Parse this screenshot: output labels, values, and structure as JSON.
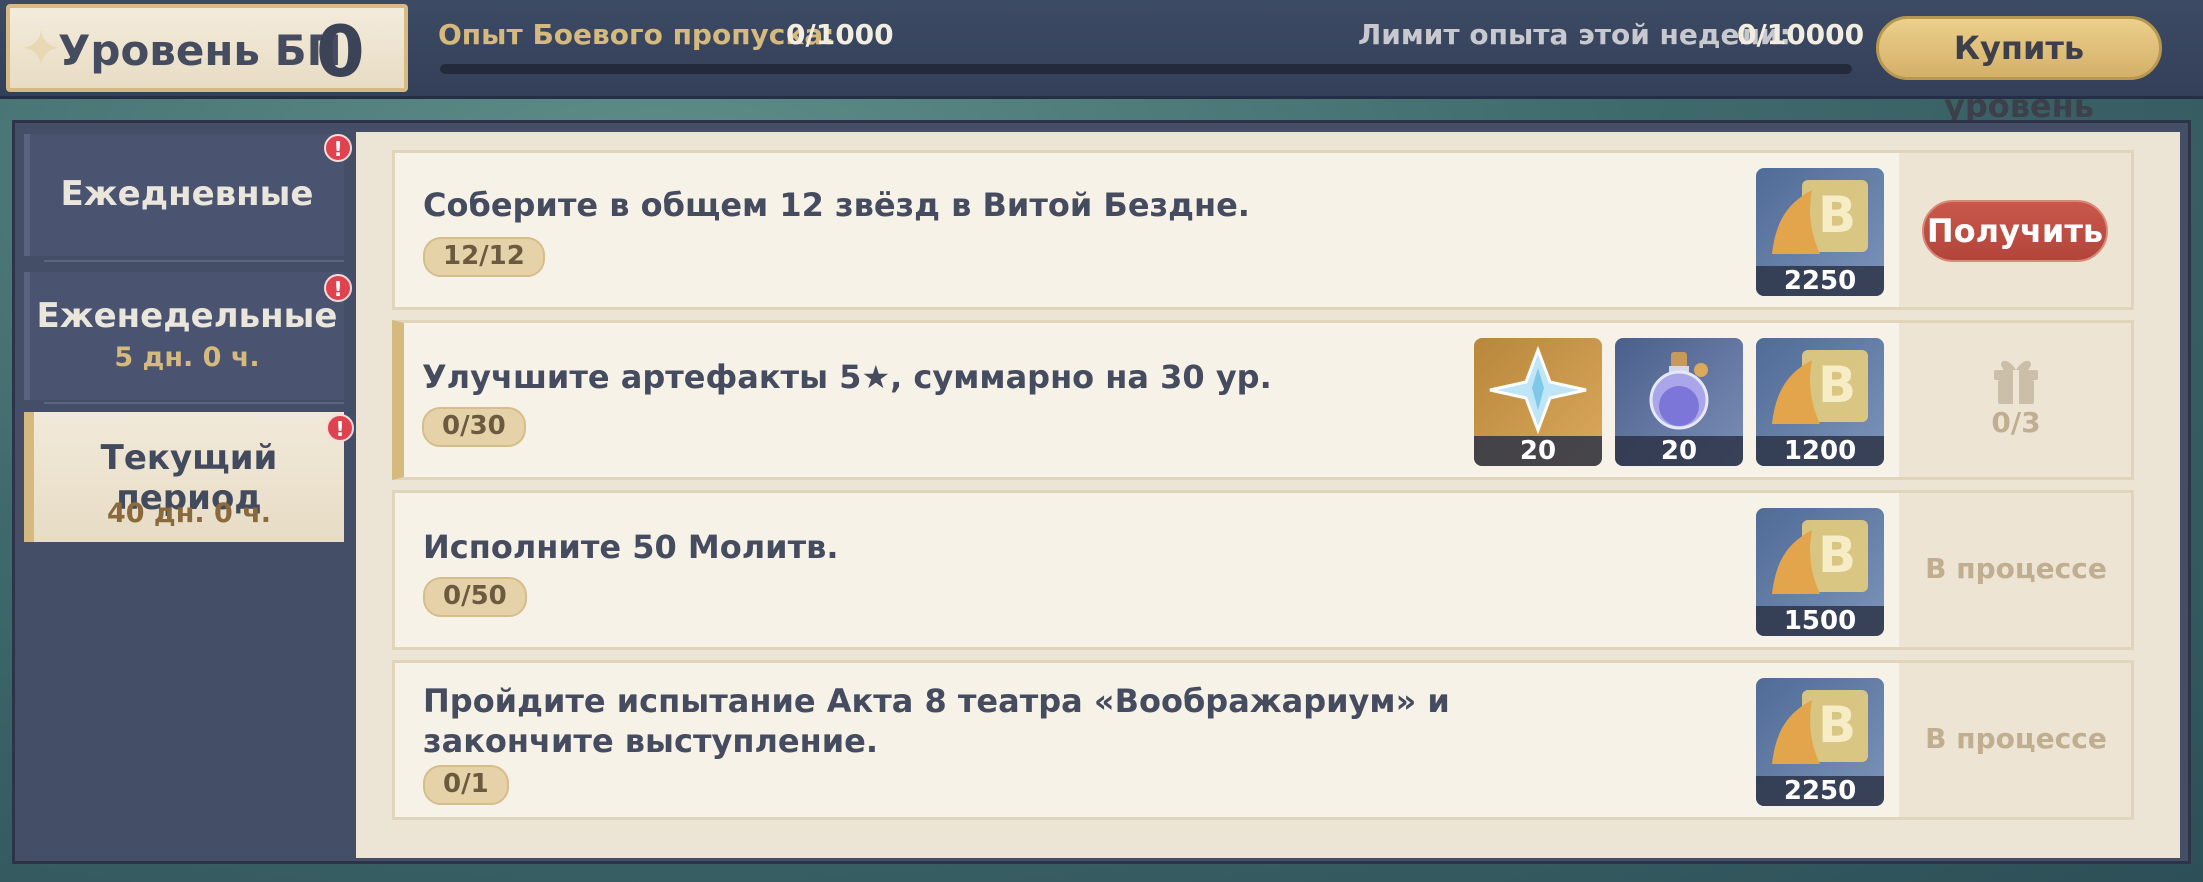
{
  "header": {
    "level_label": "Уровень БП",
    "level_value": "0",
    "exp_label": "Опыт Боевого пропуска:",
    "exp_value": "0/1000",
    "week_label": "Лимит опыта этой недели:",
    "week_value": "0/10000",
    "exp_progress_fraction": 0,
    "buy_button_label": "Купить уровень"
  },
  "tabs": [
    {
      "title": "Ежедневные",
      "subtitle": "",
      "alert": "!"
    },
    {
      "title": "Еженедельные",
      "subtitle": "5 дн. 0 ч.",
      "alert": "!"
    },
    {
      "title": "Текущий период",
      "subtitle": "40 дн. 0 ч.",
      "alert": "!"
    }
  ],
  "quests": [
    {
      "text": "Соберите в общем 12 звёзд в Витой Бездне.",
      "progress": "12/12",
      "rewards": [
        {
          "icon": "bp-exp-icon",
          "count": "2250"
        }
      ],
      "action": "Получить"
    },
    {
      "text": "Улучшите артефакты 5★, суммарно на 30 ур.",
      "progress": "0/30",
      "rewards": [
        {
          "icon": "primogem-icon",
          "count": "20"
        },
        {
          "icon": "fragile-resin-icon",
          "count": "20"
        },
        {
          "icon": "bp-exp-icon",
          "count": "1200"
        }
      ],
      "action": "0/3"
    },
    {
      "text": "Исполните 50 Молитв.",
      "progress": "0/50",
      "rewards": [
        {
          "icon": "bp-exp-icon",
          "count": "1500"
        }
      ],
      "action": "В процессе"
    },
    {
      "text": "Пройдите испытание Акта 8 театра «Воображариум» и закончите выступление.",
      "progress": "0/1",
      "rewards": [
        {
          "icon": "bp-exp-icon",
          "count": "2250"
        }
      ],
      "action": "В процессе"
    }
  ],
  "colors": {
    "accent_gold": "#d6b97c",
    "claim_red": "#b2453b",
    "panel_dark": "#454e67",
    "content_light": "#f7f2e8"
  }
}
